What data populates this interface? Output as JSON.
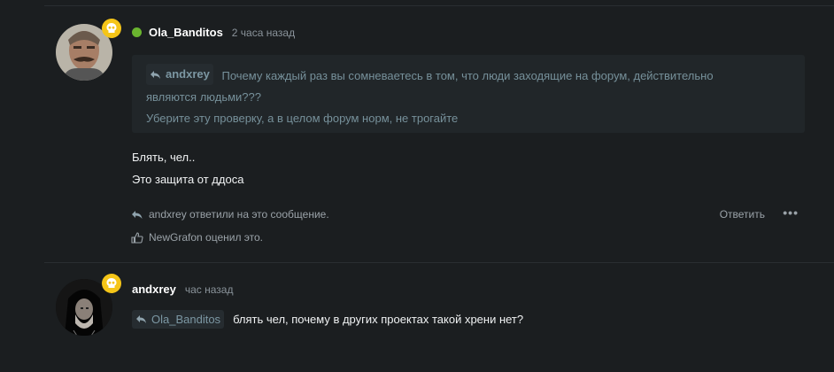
{
  "post1": {
    "username": "Ola_Banditos",
    "time": "2 часа назад",
    "quote": {
      "author": "andxrey",
      "line1": "Почему каждый раз вы сомневаетесь в том, что люди заходящие на форум, действительно",
      "line2": "являются людьми???",
      "line3": "Уберите эту проверку, а в целом форум норм, не трогайте"
    },
    "body": {
      "line1": "Блять, чел..",
      "line2": "Это защита от ддоса"
    },
    "replied": "andxrey ответили на это сообщение.",
    "reply_label": "Ответить",
    "more_label": "•••",
    "liked": "NewGrafon оценил это."
  },
  "post2": {
    "username": "andxrey",
    "time": "час назад",
    "quote_author": "Ola_Banditos",
    "text": "блять чел, почему в других проектах такой хрени нет?"
  },
  "colors": {
    "background": "#1b1e20",
    "online": "#6ab42f",
    "badge": "#f5c518",
    "quote_bg": "#212629",
    "quote_text": "#76909a"
  }
}
